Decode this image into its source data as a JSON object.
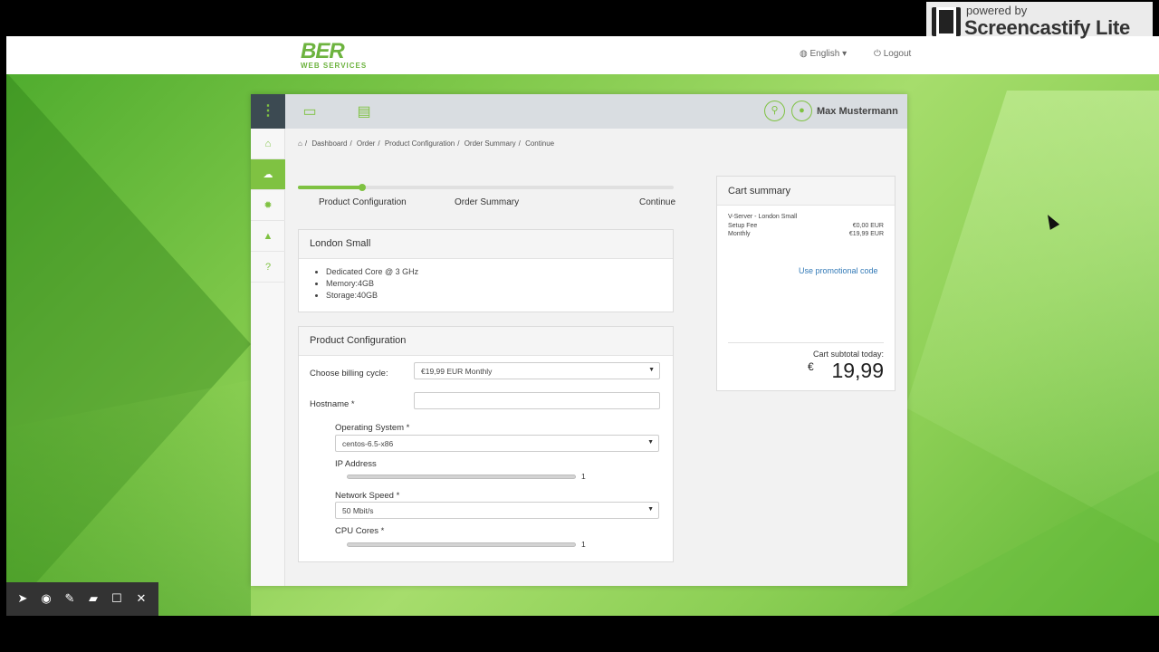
{
  "topbar": {
    "logo_mark": "BER",
    "logo_sub": "WEB SERVICES",
    "language": "English",
    "logout": "Logout"
  },
  "watermark": {
    "line1": "powered by",
    "line2": "Screencastify Lite"
  },
  "app": {
    "user_name": "Max Mustermann",
    "breadcrumb": [
      "Dashboard",
      "Order",
      "Product Configuration",
      "Order Summary",
      "Continue"
    ],
    "steps": [
      "Product Configuration",
      "Order Summary",
      "Continue"
    ],
    "progress_fraction": 0.17,
    "product": {
      "title": "London Small",
      "features": [
        "Dedicated Core @ 3 GHz",
        "Memory:4GB",
        "Storage:40GB"
      ]
    },
    "config": {
      "title": "Product Configuration",
      "billing_label": "Choose billing cycle:",
      "billing_value": "€19,99 EUR Monthly",
      "hostname_label": "Hostname *",
      "hostname_value": "",
      "os_label": "Operating System *",
      "os_value": "centos-6.5-x86",
      "ip_label": "IP Address",
      "ip_value": "1",
      "network_label": "Network Speed *",
      "network_value": "50 Mbit/s",
      "cpu_label": "CPU Cores *",
      "cpu_value": "1"
    },
    "cart": {
      "title": "Cart summary",
      "item_name": "V-Server - London Small",
      "setup_label": "Setup Fee",
      "setup_value": "€0,00 EUR",
      "monthly_label": "Monthly",
      "monthly_value": "€19,99 EUR",
      "promo": "Use promotional code",
      "subtotal_label": "Cart subtotal today:",
      "currency": "€",
      "subtotal": "19,99"
    }
  },
  "colors": {
    "accent": "#7fc242",
    "sidebar_dark": "#3c4a52",
    "link": "#337ab7"
  }
}
